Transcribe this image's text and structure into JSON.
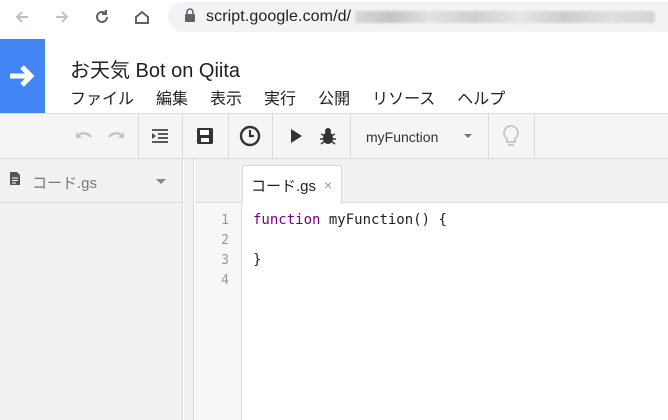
{
  "browser": {
    "url_visible": "script.google.com/d/",
    "icons": [
      "back-arrow-icon",
      "forward-arrow-icon",
      "reload-icon",
      "home-icon",
      "lock-icon"
    ]
  },
  "app": {
    "title": "お天気 Bot on Qiita",
    "menu": [
      "ファイル",
      "編集",
      "表示",
      "実行",
      "公開",
      "リソース",
      "ヘルプ"
    ]
  },
  "toolbar": {
    "function_selected": "myFunction",
    "icons": [
      "undo-icon",
      "redo-icon",
      "indent-icon",
      "save-icon",
      "triggers-clock-icon",
      "run-icon",
      "debug-bug-icon",
      "lightbulb-icon"
    ]
  },
  "files": {
    "current_file": "コード.gs"
  },
  "editor": {
    "tab_label": "コード.gs",
    "tab_close": "×",
    "lines": [
      {
        "no": "1",
        "keyword": "function",
        "rest": " myFunction() {"
      },
      {
        "no": "2",
        "keyword": "",
        "rest": ""
      },
      {
        "no": "3",
        "keyword": "",
        "rest": "}"
      },
      {
        "no": "4",
        "keyword": "",
        "rest": ""
      }
    ]
  },
  "colors": {
    "logo_blue": "#4285f4",
    "keyword_purple": "#770088",
    "toolbar_bg": "#f5f5f5"
  }
}
